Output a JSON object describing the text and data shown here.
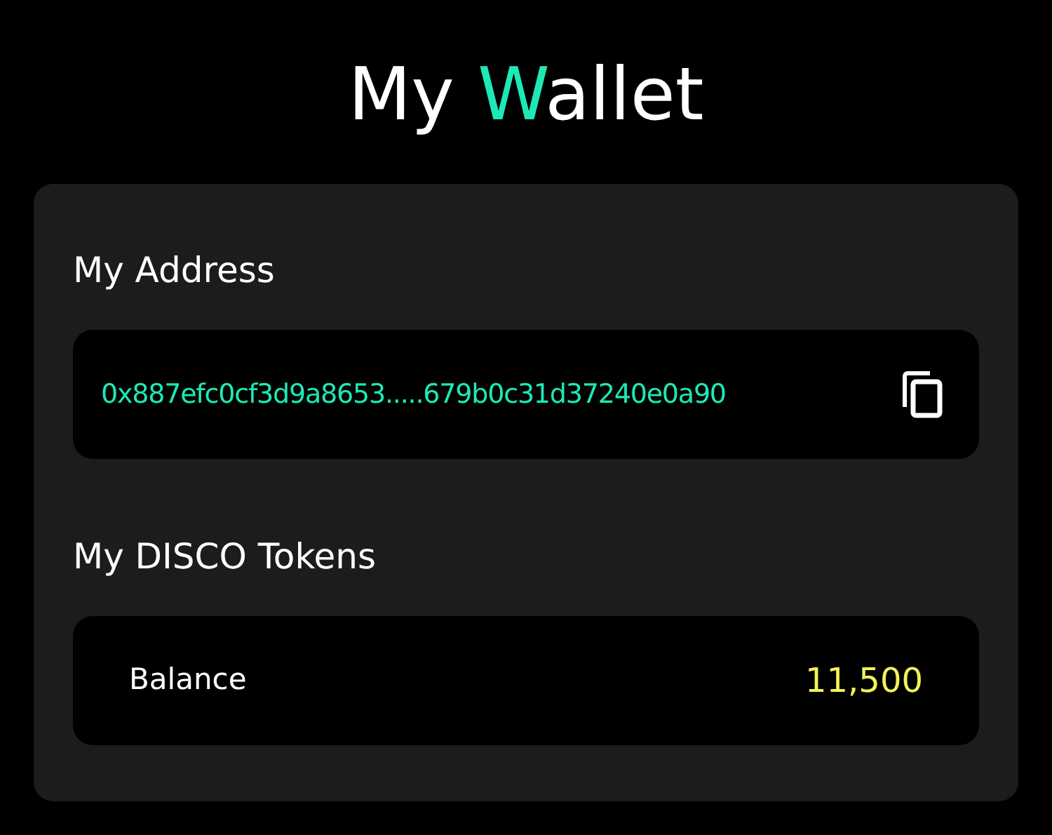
{
  "title": {
    "before": "My ",
    "accent": "W",
    "after": "allet"
  },
  "address": {
    "label": "My Address",
    "value": "0x887efc0cf3d9a8653.....679b0c31d37240e0a90"
  },
  "tokens": {
    "label": "My DISCO Tokens",
    "balance_label": "Balance",
    "balance": "11,500"
  }
}
